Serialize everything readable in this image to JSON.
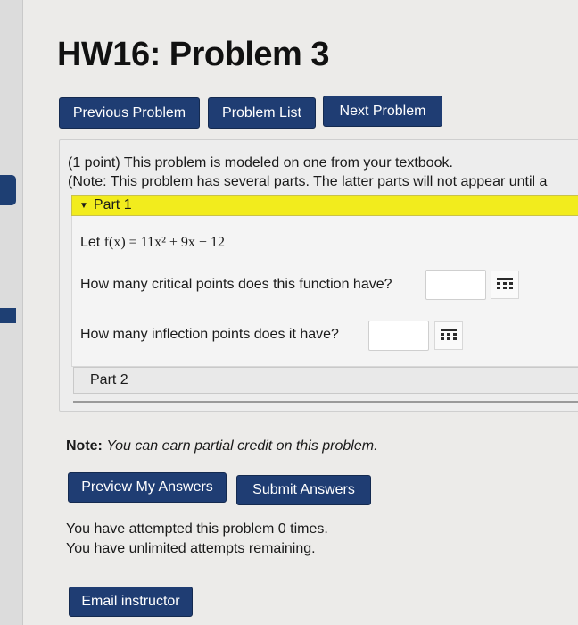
{
  "page": {
    "title": "HW16: Problem 3"
  },
  "nav": {
    "previous": "Previous Problem",
    "list": "Problem List",
    "next": "Next Problem"
  },
  "problem": {
    "intro": "(1 point) This problem is modeled on one from your textbook.",
    "note": "(Note: This problem has several parts. The latter parts will not appear until a",
    "part1": {
      "label": "Part 1",
      "function_prefix": "Let ",
      "function": "f(x) = 11x² + 9x − 12",
      "q1": "How many critical points does this function have?",
      "q1_value": "",
      "q2": "How many inflection points does it have?",
      "q2_value": ""
    },
    "part2": {
      "label": "Part 2"
    }
  },
  "footer": {
    "note_label": "Note:",
    "note_text": "You can earn partial credit on this problem.",
    "preview": "Preview My Answers",
    "submit": "Submit Answers",
    "attempts_1": "You have attempted this problem 0 times.",
    "attempts_2": "You have unlimited attempts remaining.",
    "email": "Email instructor"
  },
  "colors": {
    "button": "#1f3d73",
    "part_header": "#f2ec1d"
  },
  "icons": {
    "palette": "grid-icon",
    "caret": "caret-down-icon"
  }
}
